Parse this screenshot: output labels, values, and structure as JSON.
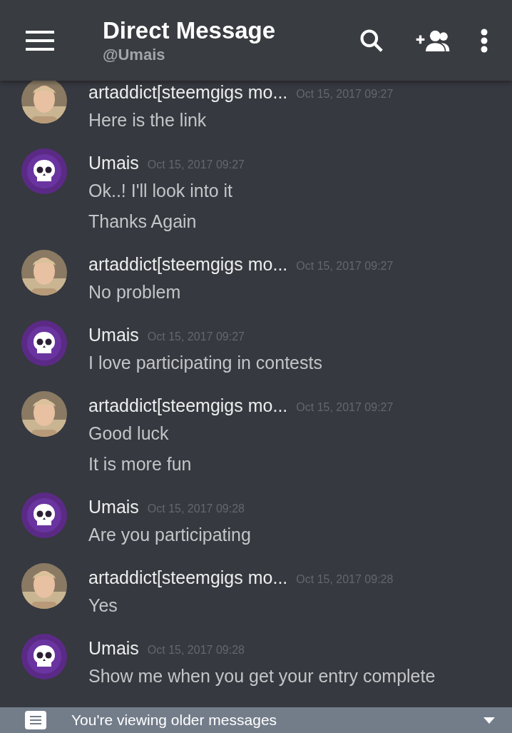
{
  "header": {
    "title": "Direct Message",
    "subtitle": "@Umais"
  },
  "messages": [
    {
      "author": "artaddict[steemgigs mo...",
      "time": "Oct 15, 2017 09:27",
      "lines": [
        "Here is the link"
      ]
    },
    {
      "author": "Umais",
      "kind": "skull",
      "time": "Oct 15, 2017 09:27",
      "lines": [
        "Ok..! I'll look into it",
        "Thanks Again"
      ]
    },
    {
      "author": "artaddict[steemgigs mo...",
      "time": "Oct 15, 2017 09:27",
      "lines": [
        "No problem"
      ]
    },
    {
      "author": "Umais",
      "kind": "skull",
      "time": "Oct 15, 2017 09:27",
      "lines": [
        "I love participating in contests"
      ]
    },
    {
      "author": "artaddict[steemgigs mo...",
      "time": "Oct 15, 2017 09:27",
      "lines": [
        "Good luck",
        "It is more fun"
      ]
    },
    {
      "author": "Umais",
      "kind": "skull",
      "time": "Oct 15, 2017 09:28",
      "lines": [
        "Are you participating"
      ]
    },
    {
      "author": "artaddict[steemgigs mo...",
      "time": "Oct 15, 2017 09:28",
      "lines": [
        "Yes"
      ]
    },
    {
      "author": "Umais",
      "kind": "skull",
      "time": "Oct 15, 2017 09:28",
      "lines": [
        "Show me when you get your entry complete"
      ]
    }
  ],
  "banner": {
    "text": "You're viewing older messages"
  }
}
